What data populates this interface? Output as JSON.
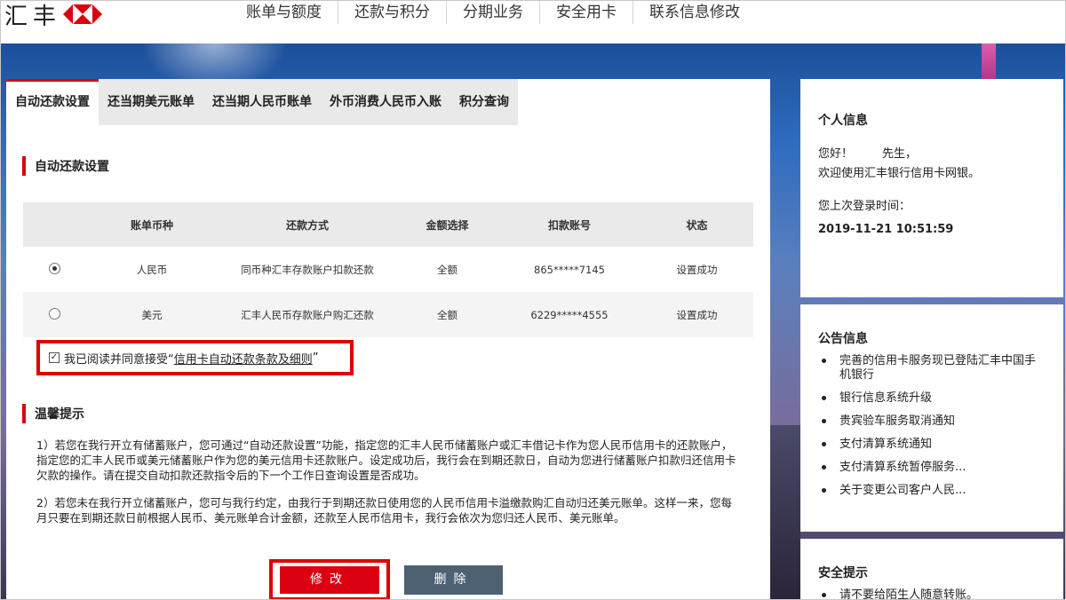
{
  "brand": {
    "name": "汇丰"
  },
  "nav": [
    "账单与额度",
    "还款与积分",
    "分期业务",
    "安全用卡",
    "联系信息修改"
  ],
  "tabs": [
    "自动还款设置",
    "还当期美元账单",
    "还当期人民币账单",
    "外币消费人民币入账",
    "积分查询"
  ],
  "autopay": {
    "section_title": "自动还款设置",
    "columns": [
      "账单币种",
      "还款方式",
      "金额选择",
      "扣款账号",
      "状态"
    ],
    "rows": [
      {
        "selected": true,
        "currency": "人民币",
        "method": "同币种汇丰存款账户扣款还款",
        "amount": "全额",
        "account": "865*****7145",
        "status": "设置成功"
      },
      {
        "selected": false,
        "currency": "美元",
        "method": "汇丰人民币存款账户购汇还款",
        "amount": "全额",
        "account": "6229*****4555",
        "status": "设置成功"
      }
    ],
    "agree_prefix": "我已阅读并同意接受“",
    "agree_link": "信用卡自动还款条款及细则",
    "agree_suffix": "”"
  },
  "tips": {
    "title": "温馨提示",
    "p1": "1）若您在我行开立有储蓄账户，您可通过“自动还款设置”功能，指定您的汇丰人民币储蓄账户或汇丰借记卡作为您人民币信用卡的还款账户，指定您的汇丰人民币或美元储蓄账户作为您的美元信用卡还款账户。设定成功后，我行会在到期还款日，自动为您进行储蓄账户扣款归还信用卡欠款的操作。请在提交自动扣款还款指令后的下一个工作日查询设置是否成功。",
    "p2": "2）若您未在我行开立储蓄账户，您可与我行约定，由我行于到期还款日使用您的人民币信用卡溢缴款购汇自动归还美元账单。这样一来，您每月只要在到期还款日前根据人民币、美元账单合计金额，还款至人民币信用卡，我行会依次为您归还人民币、美元账单。"
  },
  "buttons": {
    "modify": "修改",
    "delete": "删除"
  },
  "side": {
    "personal_title": "个人信息",
    "greeting": "您好！        先生，",
    "welcome": "欢迎使用汇丰银行信用卡网银。",
    "last_login_label": "您上次登录时间：",
    "last_login_time": "2019-11-21 10:51:59",
    "notice_title": "公告信息",
    "notices": [
      "完善的信用卡服务现已登陆汇丰中国手机银行",
      "银行信息系统升级",
      "贵宾验车服务取消通知",
      "支付清算系统通知",
      "支付清算系统暂停服务...",
      "关于变更公司客户人民..."
    ],
    "security_title": "安全提示",
    "security_items": [
      "请不要给陌生人随意转账。"
    ]
  },
  "colors": {
    "brand_red": "#db0011",
    "delete_gray": "#4d6173"
  }
}
